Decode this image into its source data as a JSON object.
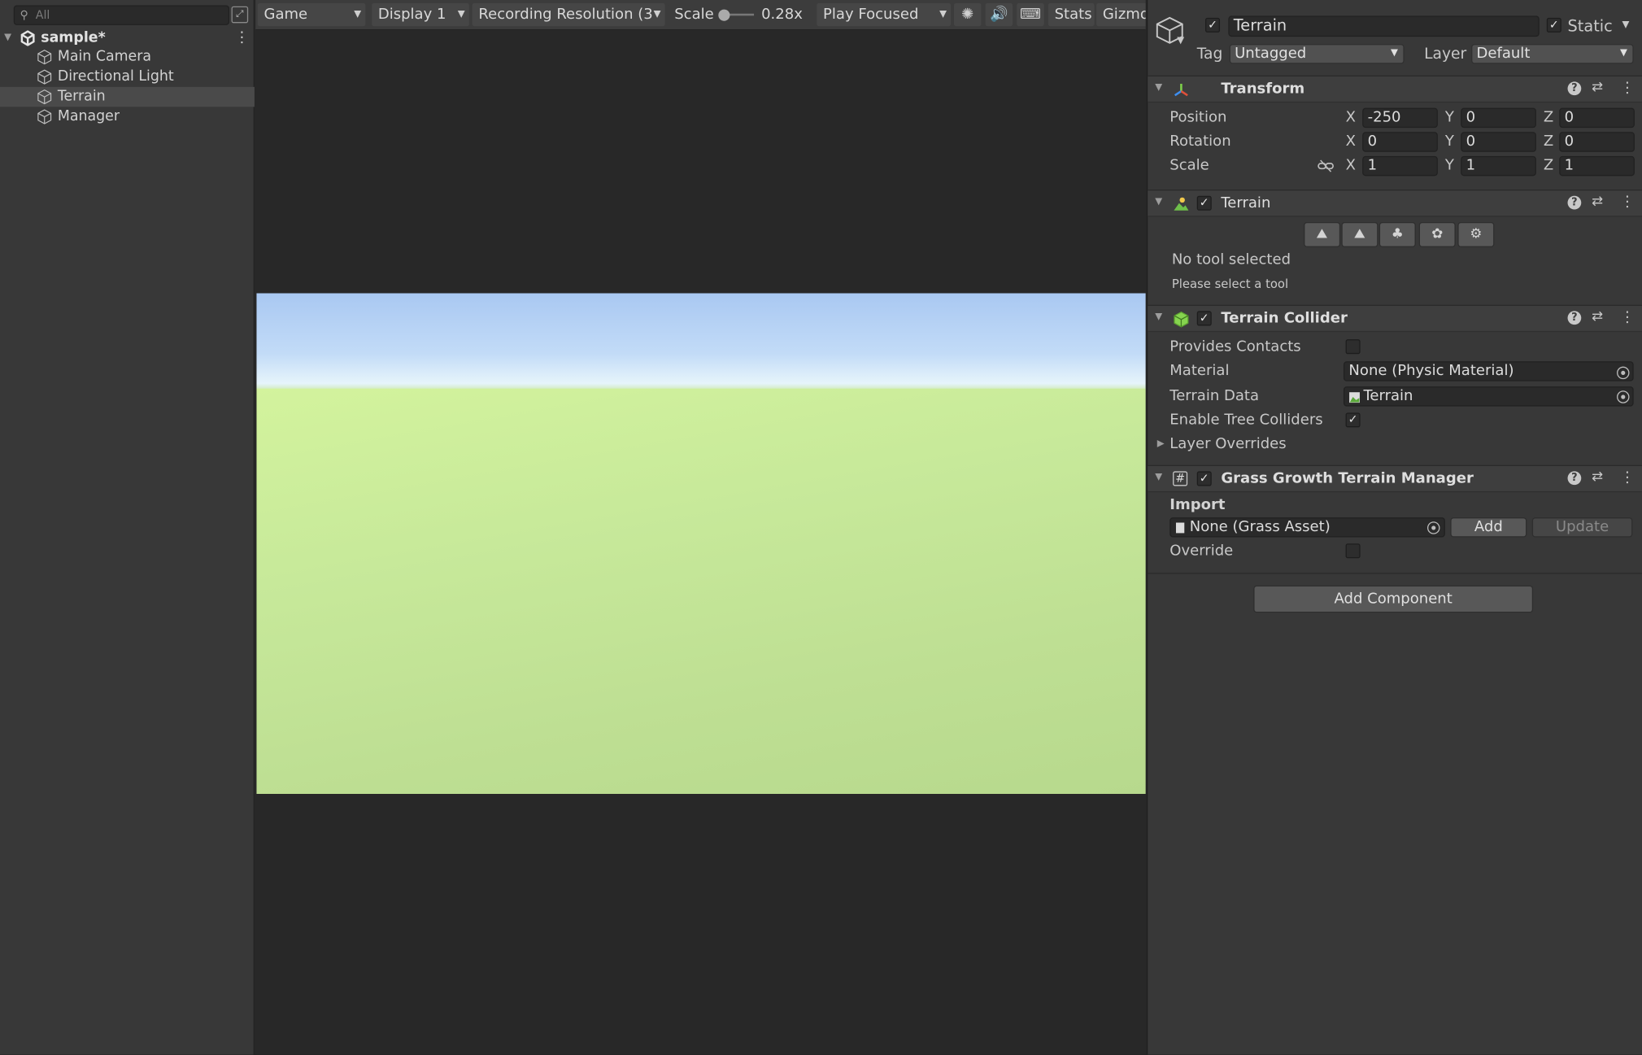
{
  "hierarchy": {
    "search_placeholder": "All",
    "scene": "sample*",
    "items": [
      {
        "label": "Main Camera"
      },
      {
        "label": "Directional Light"
      },
      {
        "label": "Terrain",
        "selected": true
      },
      {
        "label": "Manager"
      }
    ]
  },
  "game_toolbar": {
    "view": "Game",
    "display": "Display 1",
    "resolution": "Recording Resolution (3",
    "scale_label": "Scale",
    "scale_value": "0.28x",
    "play_mode": "Play Focused",
    "stats": "Stats",
    "gizmos": "Gizmo"
  },
  "inspector": {
    "object_name": "Terrain",
    "static_label": "Static",
    "tag_label": "Tag",
    "tag_value": "Untagged",
    "layer_label": "Layer",
    "layer_value": "Default",
    "transform": {
      "title": "Transform",
      "position": {
        "label": "Position",
        "x": "-250",
        "y": "0",
        "z": "0"
      },
      "rotation": {
        "label": "Rotation",
        "x": "0",
        "y": "0",
        "z": "0"
      },
      "scale": {
        "label": "Scale",
        "x": "1",
        "y": "1",
        "z": "1"
      },
      "axis_x": "X",
      "axis_y": "Y",
      "axis_z": "Z"
    },
    "terrain": {
      "title": "Terrain",
      "status": "No tool selected",
      "hint": "Please select a tool"
    },
    "collider": {
      "title": "Terrain Collider",
      "provides_contacts": "Provides Contacts",
      "material_label": "Material",
      "material_value": "None (Physic Material)",
      "terrain_data_label": "Terrain Data",
      "terrain_data_value": "Terrain",
      "enable_trees": "Enable Tree Colliders",
      "layer_overrides": "Layer Overrides"
    },
    "grass": {
      "title": "Grass Growth Terrain Manager",
      "import_label": "Import",
      "asset_value": "None (Grass Asset)",
      "add": "Add",
      "update": "Update",
      "override": "Override"
    },
    "add_component": "Add Component"
  }
}
